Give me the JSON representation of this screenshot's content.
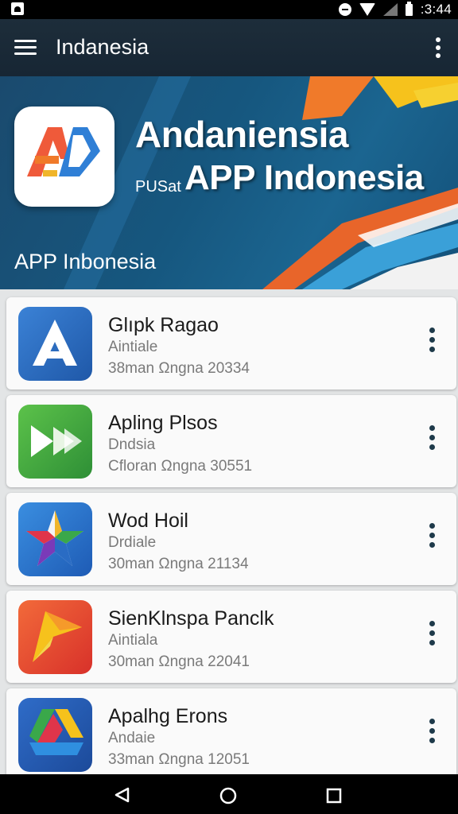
{
  "status_bar": {
    "time": ":3:44",
    "icons": [
      "notification-icon",
      "do-not-disturb-icon",
      "wifi-icon",
      "signal-icon",
      "battery-icon"
    ]
  },
  "app_bar": {
    "title": "Indanesia",
    "menu_icon": "hamburger-menu-icon",
    "overflow_icon": "more-vert-icon"
  },
  "banner": {
    "title": "Andaniensia",
    "subtitle_small": "PUSat",
    "subtitle_big": "APP Indonesia",
    "caption": "APP Inbonesia",
    "logo_icon": "app-logo-icon"
  },
  "apps": [
    {
      "name": "Glıpk Ragao",
      "category": "Aintiale",
      "meta": "38man Ωngna 20334",
      "icon": "letter-a-icon",
      "color": "#2a6cc4"
    },
    {
      "name": "Apling Plsos",
      "category": "Dndsia",
      "meta": "Cfloran Ωngna 30551",
      "icon": "fast-forward-icon",
      "color": "#3fa84a"
    },
    {
      "name": "Wod Hoil",
      "category": "Drdiale",
      "meta": "30man Ωngna 21134",
      "icon": "star-icon",
      "color": "#2a76d2"
    },
    {
      "name": "SienKlnspa Panclk",
      "category": "Aintiala",
      "meta": "30man Ωngna 22041",
      "icon": "flag-arrow-icon",
      "color": "#e64a2e"
    },
    {
      "name": "Apalhg Erons",
      "category": "Andaie",
      "meta": "33man Ωngna 12051",
      "icon": "triangle-drive-icon",
      "color": "#2d5fb8"
    }
  ],
  "nav_bar": {
    "icons": [
      "back-icon",
      "home-icon",
      "recents-icon"
    ]
  }
}
